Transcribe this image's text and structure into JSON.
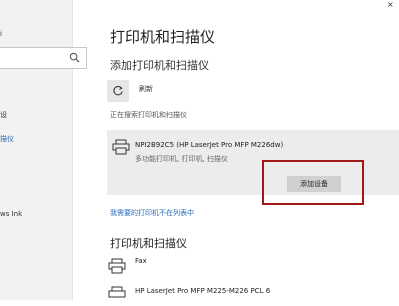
{
  "window": {
    "close_glyph": "×"
  },
  "nav": {
    "items": [
      {
        "label": "i"
      },
      {
        "label": "设"
      },
      {
        "label": "描仪"
      },
      {
        "label": "ws Ink"
      }
    ]
  },
  "page": {
    "title": "打印机和扫描仪",
    "add_section_title": "添加打印机和扫描仪",
    "refresh_label": "刷新",
    "searching_text": "正在搜索打印机和扫描仪"
  },
  "found_device": {
    "name": "NPI2B92C5 (HP LaserJet Pro MFP M226dw)",
    "description": "多功能打印机, 打印机, 扫描仪",
    "add_button": "添加设备"
  },
  "not_listed_link": "我需要的打印机不在列表中",
  "printers_section": {
    "title": "打印机和扫描仪",
    "items": [
      {
        "name": "Fax"
      },
      {
        "name": "HP LaserJet Pro MFP M225-M226 PCL 6"
      }
    ]
  },
  "colors": {
    "accent": "#2b6cb8",
    "highlight": "#a01818"
  }
}
